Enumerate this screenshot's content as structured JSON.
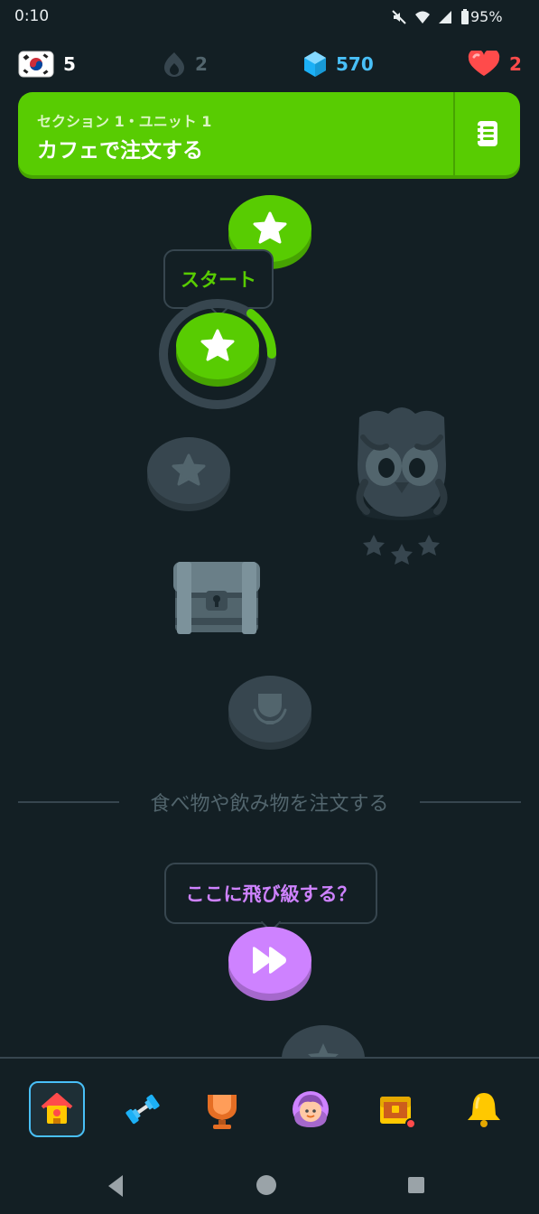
{
  "status_bar": {
    "time": "0:10",
    "battery": "95%"
  },
  "stats": {
    "course_flag": "south-korea-flag-icon",
    "course_count": "5",
    "streak": "2",
    "gems": "570",
    "hearts": "2"
  },
  "header": {
    "subtitle": "セクション 1・ユニット 1",
    "title": "カフェで注文する",
    "guide_icon": "guidebook-icon"
  },
  "path": {
    "start_tooltip": "スタート",
    "divider_text": "食べ物や飲み物を注文する",
    "jump_tooltip": "ここに飛び級する？"
  },
  "bottom_nav": [
    "home-icon",
    "practice-dumbbell-icon",
    "leaderboard-trophy-icon",
    "profile-avatar-icon",
    "shop-chest-icon",
    "notifications-bell-icon"
  ],
  "colors": {
    "background": "#131f24",
    "green": "#58cc02",
    "locked": "#37464f",
    "purple": "#ce82ff",
    "gems": "#49c0f8",
    "hearts": "#ff4b4b"
  }
}
